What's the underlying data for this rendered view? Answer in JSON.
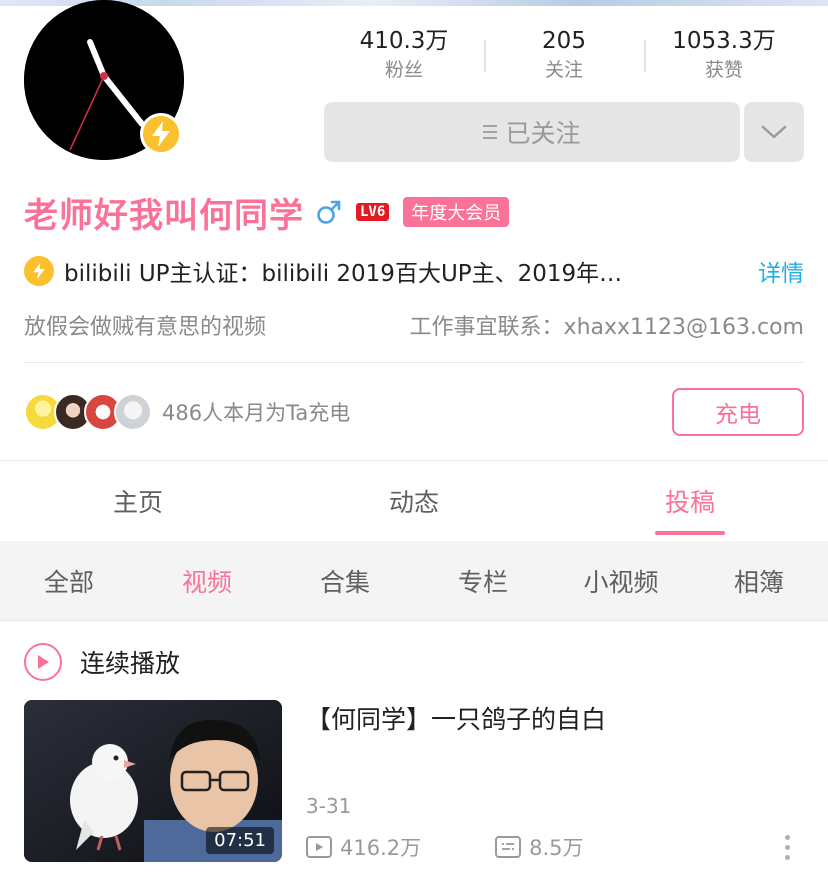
{
  "profile": {
    "name": "老师好我叫何同学",
    "level": "LV6",
    "vip_label": "年度大会员",
    "gender": "male"
  },
  "stats": [
    {
      "value": "410.3万",
      "label": "粉丝"
    },
    {
      "value": "205",
      "label": "关注"
    },
    {
      "value": "1053.3万",
      "label": "获赞"
    }
  ],
  "follow": {
    "label": "已关注"
  },
  "certification": {
    "text": "bilibili  UP主认证：bilibili  2019百大UP主、2019年…",
    "detail_label": "详情"
  },
  "signature": {
    "text": "放假会做贼有意思的视频",
    "contact": "工作事宜联系：xhaxx1123@163.com"
  },
  "charge": {
    "text": "486人本月为Ta充电",
    "button_label": "充电"
  },
  "main_tabs": [
    {
      "label": "主页"
    },
    {
      "label": "动态"
    },
    {
      "label": "投稿"
    }
  ],
  "sub_tabs": [
    {
      "label": "全部"
    },
    {
      "label": "视频"
    },
    {
      "label": "合集"
    },
    {
      "label": "专栏"
    },
    {
      "label": "小视频"
    },
    {
      "label": "相簿"
    }
  ],
  "playlist": {
    "label": "连续播放"
  },
  "videos": [
    {
      "title": "【何同学】一只鸽子的自白",
      "duration": "07:51",
      "date": "3-31",
      "plays": "416.2万",
      "danmaku": "8.5万"
    }
  ],
  "colors": {
    "accent_pink": "#fb7299",
    "link_blue": "#23ade5",
    "badge_yellow": "#fbc02d",
    "level_red": "#e21b23"
  },
  "icons": {
    "avatar_badge": "lightning-icon",
    "certification": "lightning-icon",
    "gender": "male-icon",
    "dropdown": "chevron-down-icon",
    "play": "play-circle-icon",
    "views": "play-count-icon",
    "danmaku": "danmaku-icon",
    "more": "more-vertical-icon"
  }
}
